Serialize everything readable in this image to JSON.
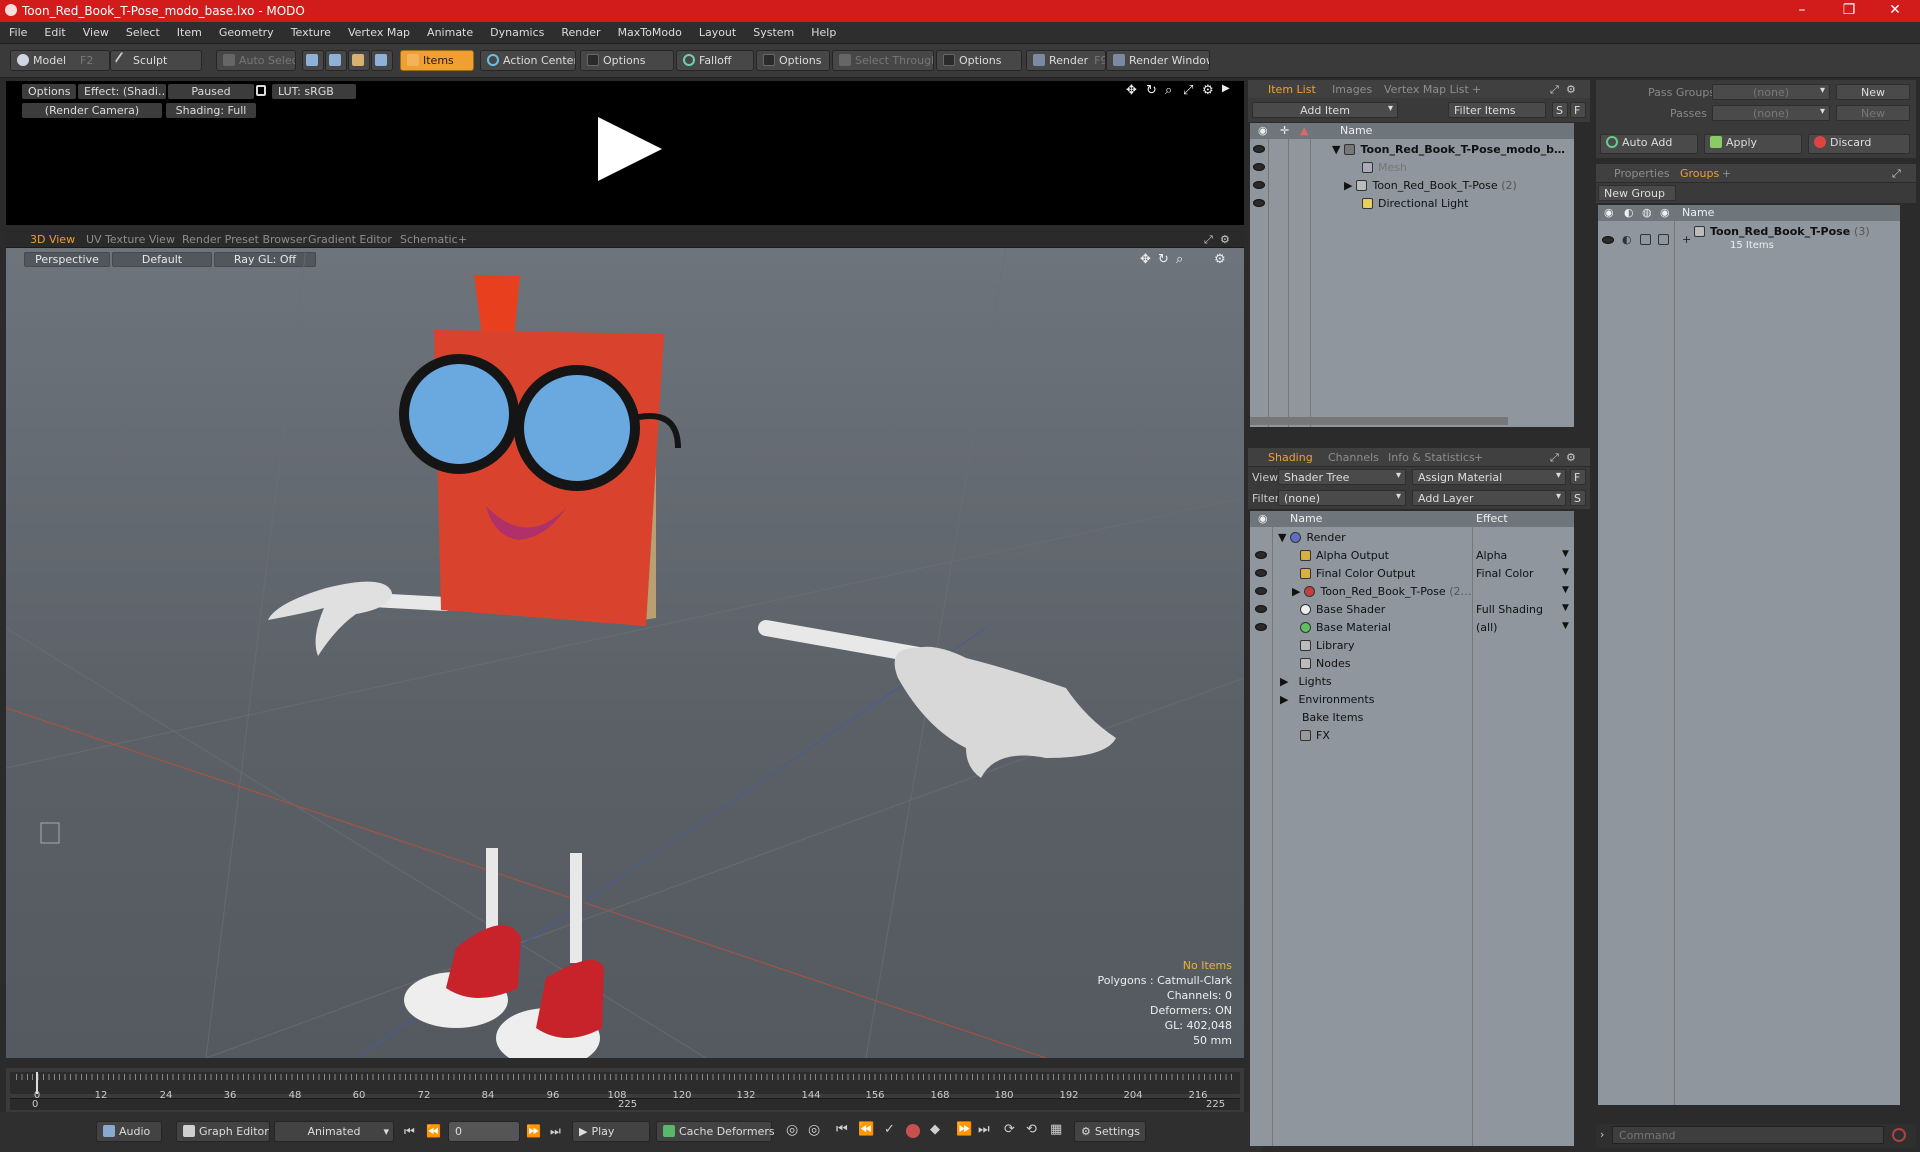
{
  "app": {
    "title": "Toon_Red_Book_T-Pose_modo_base.lxo - MODO"
  },
  "menu": [
    "File",
    "Edit",
    "View",
    "Select",
    "Item",
    "Geometry",
    "Texture",
    "Vertex Map",
    "Animate",
    "Dynamics",
    "Render",
    "MaxToModo",
    "Layout",
    "System",
    "Help"
  ],
  "toolbar": {
    "model": "Model",
    "model_key": "F2",
    "sculpt": "Sculpt",
    "auto_select": "Auto Select",
    "items": "Items",
    "action_center": "Action Center",
    "options1": "Options",
    "falloff": "Falloff",
    "options2": "Options",
    "select_through": "Select Through",
    "options3": "Options",
    "render": "Render",
    "render_key": "F9",
    "render_window": "Render Window"
  },
  "preview": {
    "options": "Options",
    "effect": "Effect: (Shadi…",
    "paused": "Paused",
    "lut": "LUT: sRGB",
    "camera": "(Render Camera)",
    "shading": "Shading: Full"
  },
  "viewport_tabs": [
    "3D View",
    "UV Texture View",
    "Render Preset Browser",
    "Gradient Editor",
    "Schematic",
    "+"
  ],
  "viewport": {
    "projection": "Perspective",
    "style": "Default",
    "raygl": "Ray GL: Off",
    "stats": {
      "no_items": "No Items",
      "polygons": "Polygons : Catmull-Clark",
      "channels": "Channels: 0",
      "deformers": "Deformers: ON",
      "gl": "GL: 402,048",
      "focal": "50 mm"
    }
  },
  "timeline": {
    "ticks": [
      "0",
      "12",
      "24",
      "36",
      "48",
      "60",
      "72",
      "84",
      "96",
      "108",
      "120",
      "132",
      "144",
      "156",
      "168",
      "180",
      "192",
      "204",
      "216"
    ],
    "start": "0",
    "mid": "225",
    "end": "225"
  },
  "bottombar": {
    "audio": "Audio",
    "graph_editor": "Graph Editor",
    "animated": "Animated",
    "frame": "0",
    "play": "Play",
    "cache_deformers": "Cache Deformers",
    "settings": "Settings"
  },
  "item_list": {
    "tabs": [
      "Item List",
      "Images",
      "Vertex Map List",
      "+"
    ],
    "add_item": "Add Item",
    "filter_items": "Filter Items",
    "btn_s": "S",
    "btn_f": "F",
    "col_name": "Name",
    "rows": [
      {
        "label": "Toon_Red_Book_T-Pose_modo_b…",
        "dim": ""
      },
      {
        "label": "Mesh",
        "dim": ""
      },
      {
        "label": "Toon_Red_Book_T-Pose",
        "dim": "(2)"
      },
      {
        "label": "Directional Light",
        "dim": ""
      }
    ]
  },
  "shading": {
    "tabs": [
      "Shading",
      "Channels",
      "Info & Statistics",
      "+"
    ],
    "view_label": "View",
    "view_value": "Shader Tree",
    "assign_material": "Assign Material",
    "btn_f": "F",
    "filter_label": "Filter",
    "filter_value": "(none)",
    "add_layer": "Add Layer",
    "btn_s": "S",
    "col_name": "Name",
    "col_effect": "Effect",
    "rows": [
      {
        "label": "Render",
        "effect": ""
      },
      {
        "label": "Alpha Output",
        "effect": "Alpha"
      },
      {
        "label": "Final Color Output",
        "effect": "Final Color"
      },
      {
        "label": "Toon_Red_Book_T-Pose",
        "dim": "(2…",
        "effect": ""
      },
      {
        "label": "Base Shader",
        "effect": "Full Shading"
      },
      {
        "label": "Base Material",
        "effect": "(all)"
      },
      {
        "label": "Library",
        "effect": ""
      },
      {
        "label": "Nodes",
        "effect": ""
      },
      {
        "label": "Lights",
        "effect": ""
      },
      {
        "label": "Environments",
        "effect": ""
      },
      {
        "label": "Bake Items",
        "effect": ""
      },
      {
        "label": "FX",
        "effect": ""
      }
    ]
  },
  "groups": {
    "pass_groups": "Pass Groups",
    "pass_groups_value": "(none)",
    "new": "New",
    "passes": "Passes",
    "passes_value": "(none)",
    "new2": "New",
    "auto_add": "Auto Add",
    "apply": "Apply",
    "discard": "Discard",
    "tabs": [
      "Properties",
      "Groups",
      "+"
    ],
    "new_group": "New Group",
    "col_name": "Name",
    "group_name": "Toon_Red_Book_T-Pose",
    "group_count": "(3)",
    "group_items": "15 Items",
    "command_placeholder": "Command"
  }
}
